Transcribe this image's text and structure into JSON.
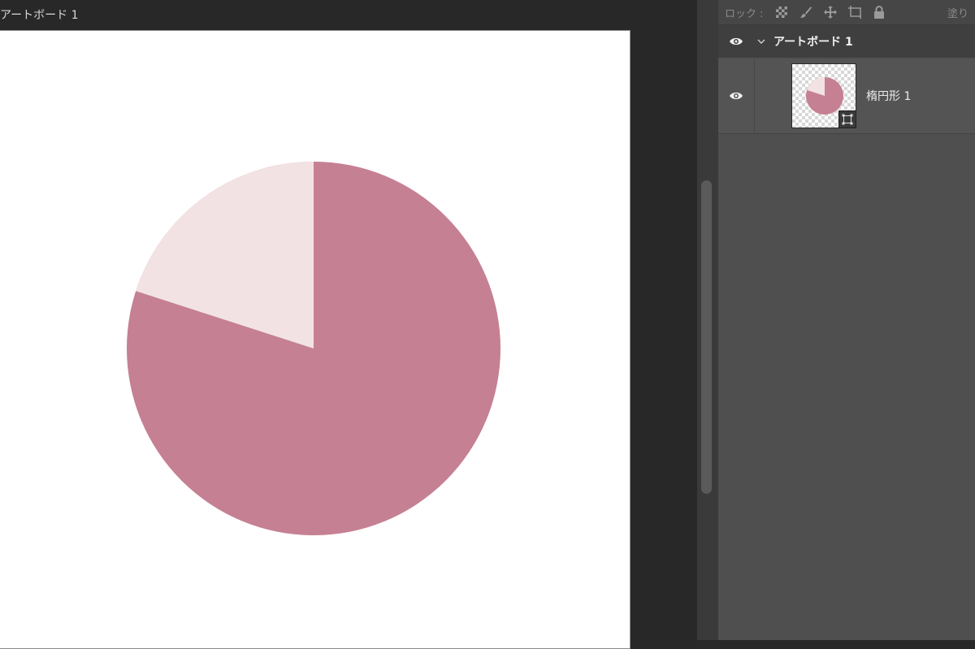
{
  "canvas": {
    "artboard_label": "アートボード 1",
    "shape_colors": {
      "main": "#c58093",
      "slice": "#f2e2e4"
    }
  },
  "layers_panel": {
    "lock_label": "ロック :",
    "lock_icons": [
      "lock-transparent-pixels-icon",
      "lock-image-pixels-icon",
      "lock-position-icon",
      "artboard-autonest-icon",
      "lock-all-icon"
    ],
    "fill_label": "塗り",
    "group": {
      "name": "アートボード 1",
      "visible": true,
      "expanded": true
    },
    "layers": [
      {
        "name": "楕円形 1",
        "visible": true,
        "type_icon": "shape-layer-icon"
      }
    ]
  }
}
